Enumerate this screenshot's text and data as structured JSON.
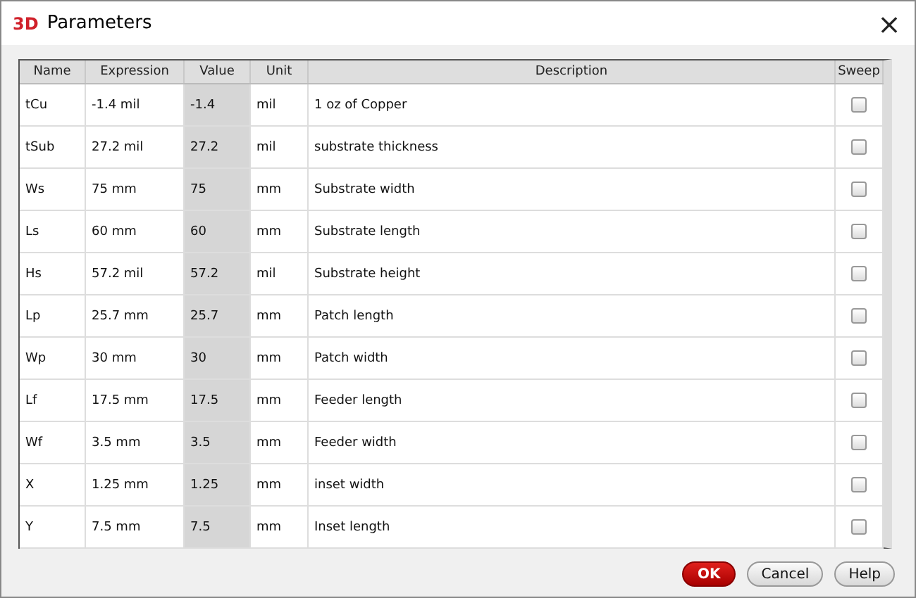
{
  "window": {
    "logo": "3D",
    "title": "Parameters",
    "close": "×"
  },
  "table": {
    "columns": [
      "Name",
      "Expression",
      "Value",
      "Unit",
      "Description",
      "Sweep"
    ],
    "rows": [
      {
        "name": "tCu",
        "expression": "-1.4 mil",
        "value": "-1.4",
        "unit": "mil",
        "description": "1 oz of Copper",
        "sweep": false
      },
      {
        "name": "tSub",
        "expression": "27.2 mil",
        "value": "27.2",
        "unit": "mil",
        "description": "substrate thickness",
        "sweep": false
      },
      {
        "name": "Ws",
        "expression": "75 mm",
        "value": "75",
        "unit": "mm",
        "description": "Substrate width",
        "sweep": false
      },
      {
        "name": "Ls",
        "expression": "60 mm",
        "value": "60",
        "unit": "mm",
        "description": "Substrate length",
        "sweep": false
      },
      {
        "name": "Hs",
        "expression": "57.2 mil",
        "value": "57.2",
        "unit": "mil",
        "description": "Substrate height",
        "sweep": false
      },
      {
        "name": "Lp",
        "expression": "25.7 mm",
        "value": "25.7",
        "unit": "mm",
        "description": "Patch length",
        "sweep": false
      },
      {
        "name": "Wp",
        "expression": "30 mm",
        "value": "30",
        "unit": "mm",
        "description": "Patch width",
        "sweep": false
      },
      {
        "name": "Lf",
        "expression": "17.5 mm",
        "value": "17.5",
        "unit": "mm",
        "description": "Feeder length",
        "sweep": false
      },
      {
        "name": "Wf",
        "expression": "3.5 mm",
        "value": "3.5",
        "unit": "mm",
        "description": "Feeder width",
        "sweep": false
      },
      {
        "name": "X",
        "expression": "1.25 mm",
        "value": "1.25",
        "unit": "mm",
        "description": "inset width",
        "sweep": false
      },
      {
        "name": "Y",
        "expression": "7.5 mm",
        "value": "7.5",
        "unit": "mm",
        "description": "Inset length",
        "sweep": false
      }
    ]
  },
  "buttons": [
    {
      "label": "OK",
      "kind": "primary"
    },
    {
      "label": "Cancel",
      "kind": "normal"
    },
    {
      "label": "Help",
      "kind": "normal"
    }
  ]
}
